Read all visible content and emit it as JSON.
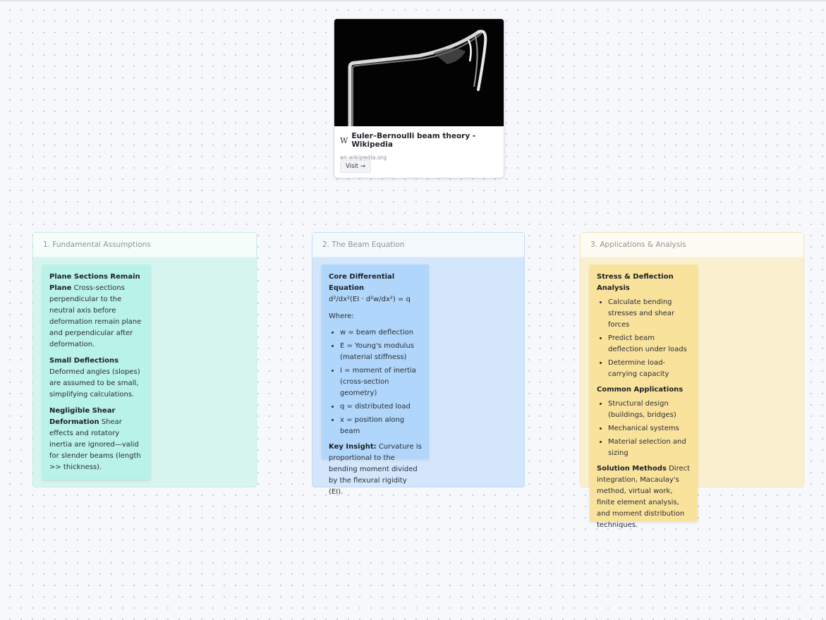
{
  "link_card": {
    "icon": "W",
    "title": "Euler–Bernoulli beam theory - Wikipedia",
    "domain": "en.wikipedia.org",
    "visit_label": "Visit →"
  },
  "frames": [
    {
      "title": "1. Fundamental Assumptions"
    },
    {
      "title": "2. The Beam Equation"
    },
    {
      "title": "3. Applications & Analysis"
    }
  ],
  "note1": {
    "p1_head": "Plane Sections Remain Plane",
    "p1_body": " Cross-sections perpendicular to the neutral axis before deformation remain plane and perpendicular after deformation.",
    "p2_head": "Small Deflections",
    "p2_body": " Deformed angles (slopes) are assumed to be small, simplifying calculations.",
    "p3_head": "Negligible Shear Deformation",
    "p3_body": " Shear effects and rotatory inertia are ignored—valid for slender beams (length >> thickness)."
  },
  "note2": {
    "heading": "Core Differential Equation",
    "equation": "d²/dx²(EI · d²w/dx²) = q",
    "where": "Where:",
    "vars": [
      "w = beam deflection",
      "E = Young's modulus (material stiffness)",
      "I = moment of inertia (cross-section geometry)",
      "q = distributed load",
      "x = position along beam"
    ],
    "insight_head": "Key Insight:",
    "insight_body": " Curvature is proportional to the bending moment divided by the flexural rigidity (EI)."
  },
  "note3": {
    "heading1": "Stress & Deflection Analysis",
    "list1": [
      "Calculate bending stresses and shear forces",
      "Predict beam deflection under loads",
      "Determine load-carrying capacity"
    ],
    "heading2": "Common Applications",
    "list2": [
      "Structural design (buildings, bridges)",
      "Mechanical systems",
      "Material selection and sizing"
    ],
    "methods_head": "Solution Methods",
    "methods_body": " Direct integration, Macaulay's method, virtual work, finite element analysis, and moment distribution techniques."
  }
}
